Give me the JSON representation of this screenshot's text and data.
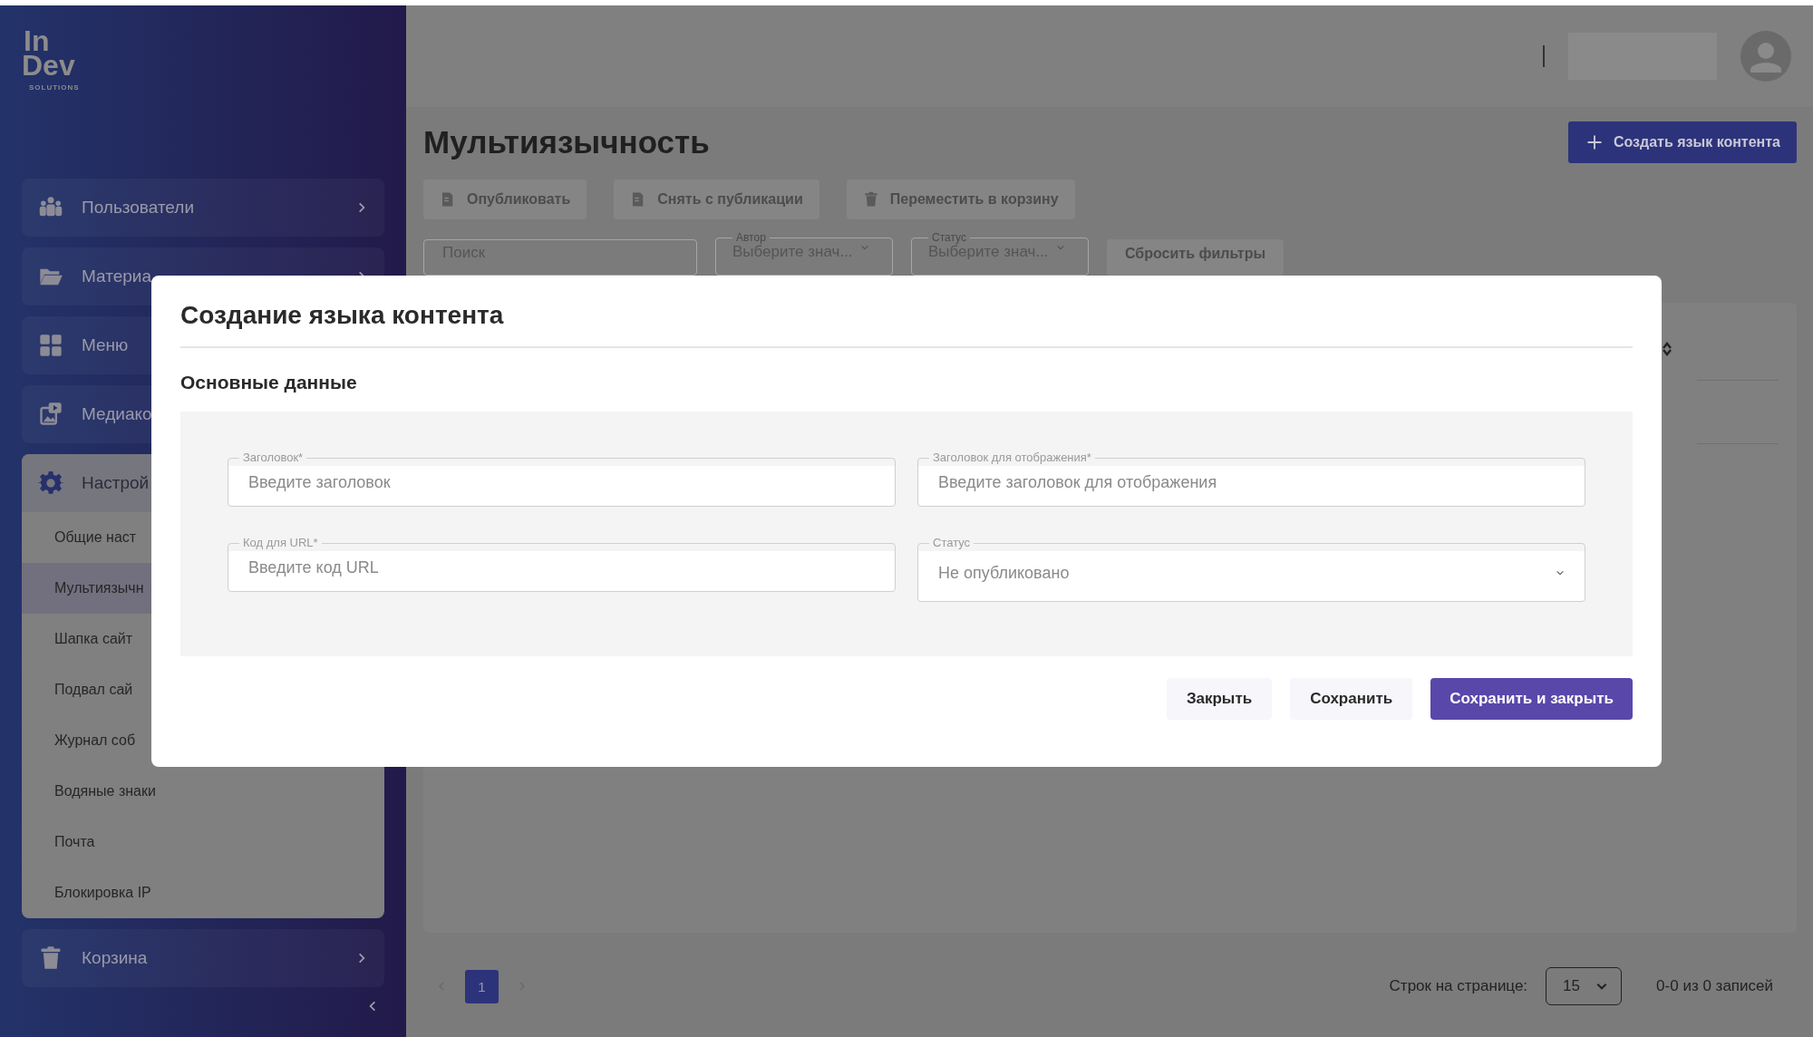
{
  "sidebar": {
    "logo": {
      "top": "In",
      "bottom": "Dev",
      "tagline": "SOLUTIONS"
    },
    "items": [
      {
        "kind": "users",
        "label": "Пользователи",
        "expanded": false
      },
      {
        "kind": "folder",
        "label": "Материа",
        "expanded": false
      },
      {
        "kind": "grid",
        "label": "Меню",
        "expanded": false
      },
      {
        "kind": "media",
        "label": "Медиако",
        "expanded": false
      },
      {
        "kind": "gear",
        "label": "Настрой",
        "expanded": true,
        "children": [
          {
            "label": "Общие наст",
            "selected": false
          },
          {
            "label": "Мультиязычн",
            "selected": true
          },
          {
            "label": "Шапка сайт",
            "selected": false
          },
          {
            "label": "Подвал сай",
            "selected": false
          },
          {
            "label": "Журнал соб",
            "selected": false
          },
          {
            "label": "Водяные знаки",
            "selected": false
          },
          {
            "label": "Почта",
            "selected": false
          },
          {
            "label": "Блокировка IP",
            "selected": false
          }
        ]
      },
      {
        "kind": "trash",
        "label": "Корзина",
        "expanded": false
      }
    ]
  },
  "page": {
    "title": "Мультиязычность",
    "create_button": "Создать язык контента",
    "actions": [
      {
        "kind": "doc",
        "label": "Опубликовать"
      },
      {
        "kind": "doc",
        "label": "Снять с публикации"
      },
      {
        "kind": "trash",
        "label": "Переместить в корзину"
      }
    ],
    "filters": {
      "search": {
        "placeholder": "Поиск"
      },
      "selects": [
        {
          "label": "Автор",
          "placeholder": "Выберите знач..."
        },
        {
          "label": "Статус",
          "placeholder": "Выберите знач..."
        }
      ],
      "reset": "Сбросить фильтры"
    },
    "pagination": {
      "pages": [
        {
          "label": "1",
          "selected": true
        }
      ],
      "rows_label": "Строк на странице:",
      "rows_value": "15",
      "range": "0-0 из 0 записей"
    }
  },
  "modal": {
    "title": "Создание языка контента",
    "section": "Основные данные",
    "fields": [
      {
        "kind": "text",
        "label": "Заголовок*",
        "placeholder": "Введите заголовок"
      },
      {
        "kind": "text",
        "label": "Заголовок для отображения*",
        "placeholder": "Введите заголовок для отображения"
      },
      {
        "kind": "text",
        "label": "Код для URL*",
        "placeholder": "Введите код URL"
      },
      {
        "kind": "select",
        "label": "Статус",
        "value": "Не опубликовано"
      }
    ],
    "buttons": [
      {
        "kind": "secondary",
        "label": "Закрыть"
      },
      {
        "kind": "secondary",
        "label": "Сохранить"
      },
      {
        "kind": "primary",
        "label": "Сохранить и закрыть"
      }
    ]
  }
}
